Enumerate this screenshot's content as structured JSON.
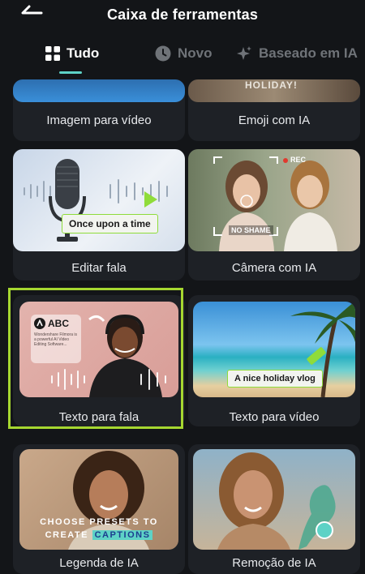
{
  "header": {
    "title": "Caixa de ferramentas"
  },
  "tabs": [
    {
      "label": "Tudo",
      "icon": "grid-icon",
      "active": true
    },
    {
      "label": "Novo",
      "icon": "clock-icon",
      "active": false
    },
    {
      "label": "Baseado em IA",
      "icon": "sparkle-icon",
      "active": false
    }
  ],
  "tools": [
    {
      "label": "Imagem para vídeo"
    },
    {
      "label": "Emoji com IA",
      "thumb_text": "HOLIDAY!"
    },
    {
      "label": "Editar fala",
      "thumb_text": "Once upon a time"
    },
    {
      "label": "Câmera com IA",
      "thumb_text": "NO SHAME",
      "rec": "REC"
    },
    {
      "label": "Texto para fala",
      "thumb_text": "ABC",
      "thumb_small": "Wondershare Filmora is a powerful AI Video Editing Software...",
      "selected": true
    },
    {
      "label": "Texto para vídeo",
      "thumb_text": "A nice holiday vlog"
    },
    {
      "label": "Legenda de IA",
      "thumb_line1": "CHOOSE PRESETS TO",
      "thumb_line2": "CREATE",
      "thumb_highlight": "CAPTIONS"
    },
    {
      "label": "Remoção de IA"
    }
  ],
  "colors": {
    "accent": "#5ed2c6",
    "selection": "#a6d730",
    "background": "#131518",
    "card": "#1e2126"
  }
}
